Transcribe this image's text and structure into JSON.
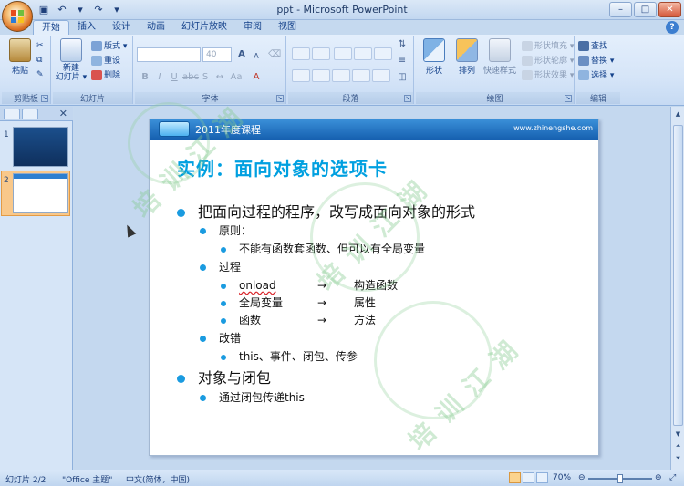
{
  "window": {
    "title": "ppt - Microsoft PowerPoint"
  },
  "ribbon_tabs": [
    "开始",
    "插入",
    "设计",
    "动画",
    "幻灯片放映",
    "审阅",
    "视图"
  ],
  "ribbon": {
    "clipboard": {
      "paste": "粘贴",
      "label": "剪贴板"
    },
    "slides": {
      "new_slide": "新建\n幻灯片 ▾",
      "layout": "版式 ▾",
      "reset": "重设",
      "delete": "删除",
      "label": "幻灯片"
    },
    "font": {
      "size": "40",
      "grow": "A",
      "shrink": "A",
      "label": "字体"
    },
    "paragraph": {
      "label": "段落"
    },
    "drawing": {
      "shapes": "形状",
      "arrange": "排列",
      "quick_styles": "快速样式",
      "fill": "形状填充 ▾",
      "outline": "形状轮廓 ▾",
      "effects": "形状效果 ▾",
      "label": "绘图"
    },
    "editing": {
      "find": "查找",
      "replace": "替换 ▾",
      "select": "选择 ▾",
      "label": "编辑"
    }
  },
  "thumbnails": [
    "1",
    "2"
  ],
  "slide": {
    "course": "2011年度课程",
    "url": "www.zhinengshe.com",
    "title": "实例：面向对象的选项卡",
    "bullet1": "把面向过程的程序，改写成面向对象的形式",
    "sub_principle": "原则：",
    "principle_item": "不能有函数套函数、但可以有全局变量",
    "sub_process": "过程",
    "process_rows": [
      {
        "from": "onload",
        "arrow": "→",
        "to": "构造函数"
      },
      {
        "from": "全局变量",
        "arrow": "→",
        "to": "属性"
      },
      {
        "from": "函数",
        "arrow": "→",
        "to": "方法"
      }
    ],
    "sub_fix": "改错",
    "fix_item": "this、事件、闭包、传参",
    "bullet2": "对象与闭包",
    "closure_item": "通过闭包传递this"
  },
  "watermark": "培训江湖",
  "status": {
    "slide": "幻灯片 2/2",
    "theme": "\"Office 主题\"",
    "language": "中文(简体，中国)",
    "zoom": "70%"
  }
}
